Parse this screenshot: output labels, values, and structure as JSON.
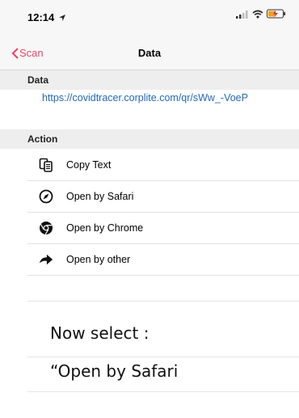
{
  "status": {
    "time": "12:14"
  },
  "nav": {
    "back_label": "Scan",
    "title": "Data"
  },
  "data_section": {
    "header": "Data",
    "url": "https://covidtracer.corplite.com/qr/sWw_-VoeP"
  },
  "action_section": {
    "header": "Action",
    "items": [
      {
        "label": "Copy Text",
        "icon": "copy-icon"
      },
      {
        "label": "Open by Safari",
        "icon": "compass-icon"
      },
      {
        "label": "Open by Chrome",
        "icon": "chrome-icon"
      },
      {
        "label": "Open by other",
        "icon": "share-arrow-icon"
      }
    ]
  },
  "instruction": {
    "line1": "Now select :",
    "line2": "“Open by Safari"
  },
  "colors": {
    "accent": "#e8496c",
    "link": "#2467b8"
  }
}
